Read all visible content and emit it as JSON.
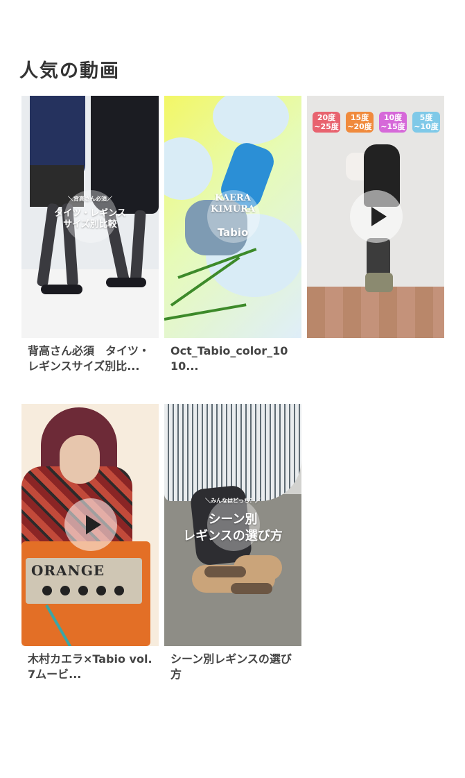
{
  "section": {
    "title": "人気の動画"
  },
  "videos": [
    {
      "title": "背高さん必須　タイツ・レギンスサイズ別比...",
      "overlay_small": "＼背高さん必須／",
      "overlay_line1": "タイツ・レギンス",
      "overlay_line2": "サイズ別比較"
    },
    {
      "title": "Oct_Tabio_color_1010...",
      "overlay_line1": "KAERA",
      "overlay_line2": "KIMURA",
      "overlay_line3": "Tabio"
    },
    {
      "title": "",
      "temps": [
        {
          "label1": "20度",
          "label2": "~25度",
          "color": "#e8636f"
        },
        {
          "label1": "15度",
          "label2": "~20度",
          "color": "#f08a3c"
        },
        {
          "label1": "10度",
          "label2": "~15度",
          "color": "#d669d9"
        },
        {
          "label1": "5度",
          "label2": "~10度",
          "color": "#7fc9e8"
        }
      ]
    },
    {
      "title": "木村カエラ×Tabio vol.7ムービ...",
      "brand": "ORANGE"
    },
    {
      "title": "シーン別レギンスの選び方",
      "overlay_small": "＼みんなはどっち？／",
      "overlay_line1": "シーン別",
      "overlay_line2": "レギンスの選び方"
    }
  ]
}
